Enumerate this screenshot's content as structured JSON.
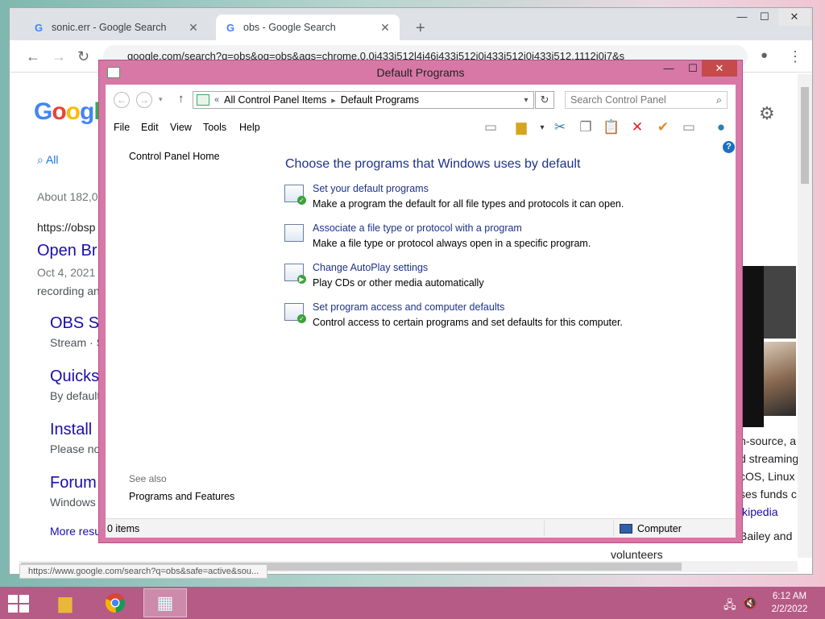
{
  "browser": {
    "tabs": [
      {
        "label": "sonic.err - Google Search",
        "active": false
      },
      {
        "label": "obs - Google Search",
        "active": true
      }
    ],
    "new_tab": "+",
    "url": "google.com/search?q=obs&oq=obs&aqs=chrome.0.0i433i512l4j46i433i512j0i433i512j0i433i512.1112j0j7&s",
    "logo": [
      "G",
      "o",
      "o",
      "g",
      "l"
    ],
    "search_tab_all": "All",
    "result_count": "About 182,0",
    "result_url": "https://obsp",
    "results": [
      {
        "title": "Open Br",
        "line1": "Oct 4, 2021",
        "line2": "recording an"
      },
      {
        "title": "OBS S",
        "line1": "Stream · S"
      },
      {
        "title": "Quicks",
        "line1": "By default"
      },
      {
        "title": "Install",
        "line1": "Please no"
      },
      {
        "title": "Forum",
        "line1": "Windows"
      }
    ],
    "more_results": "More resu",
    "right_snippets": [
      "n-source, a",
      "d streaming",
      "cOS, Linux",
      "ses funds c",
      "ikipedia",
      "Bailey and",
      "volunteers"
    ],
    "status_url": "https://www.google.com/search?q=obs&safe=active&sou..."
  },
  "window": {
    "title": "Default Programs",
    "address": {
      "root": "All Control Panel Items",
      "current": "Default Programs"
    },
    "search_placeholder": "Search Control Panel",
    "menu": [
      "File",
      "Edit",
      "View",
      "Tools",
      "Help"
    ],
    "left_pane": {
      "home": "Control Panel Home",
      "see_also": "See also",
      "programs_features": "Programs and Features"
    },
    "heading": "Choose the programs that Windows uses by default",
    "tasks": [
      {
        "link": "Set your default programs",
        "desc": "Make a program the default for all file types and protocols it can open."
      },
      {
        "link": "Associate a file type or protocol with a program",
        "desc": "Make a file type or protocol always open in a specific program."
      },
      {
        "link": "Change AutoPlay settings",
        "desc": "Play CDs or other media automatically"
      },
      {
        "link": "Set program access and computer defaults",
        "desc": "Control access to certain programs and set defaults for this computer."
      }
    ],
    "status": {
      "items": "0 items",
      "location": "Computer"
    }
  },
  "taskbar": {
    "time": "6:12 AM",
    "date": "2/2/2022"
  }
}
